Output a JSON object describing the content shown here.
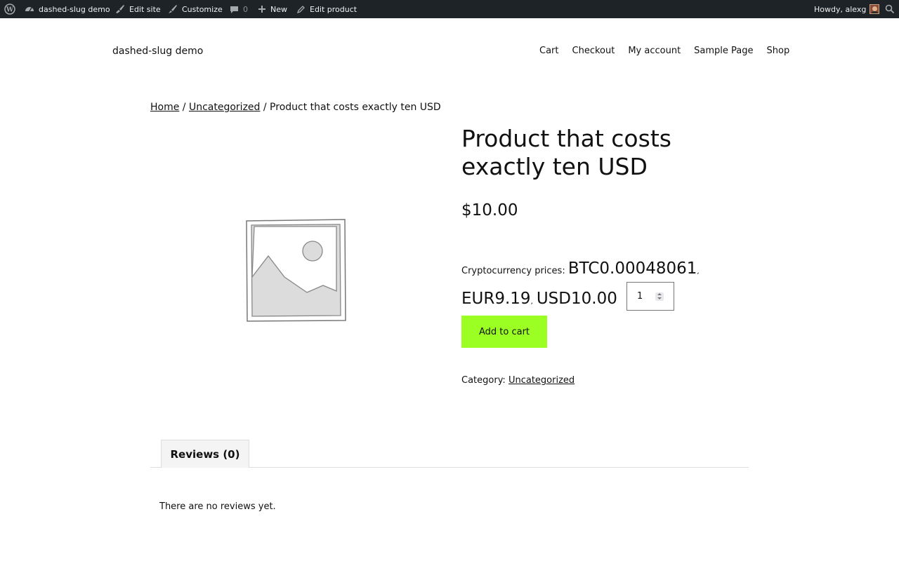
{
  "admin_bar": {
    "site_name": "dashed-slug demo",
    "edit_site": "Edit site",
    "customize": "Customize",
    "comments_count": "0",
    "new": "New",
    "edit_product": "Edit product",
    "howdy": "Howdy, alexg"
  },
  "header": {
    "site_title": "dashed-slug demo",
    "nav": [
      "Cart",
      "Checkout",
      "My account",
      "Sample Page",
      "Shop"
    ]
  },
  "breadcrumb": {
    "home": "Home",
    "separator": " / ",
    "category": "Uncategorized",
    "current": "Product that costs exactly ten USD"
  },
  "product": {
    "title": "Product that costs exactly ten USD",
    "price": "$10.00",
    "crypto_label": "Cryptocurrency prices: ",
    "crypto_prices": [
      "BTC0.00048061",
      "EUR9.19",
      "USD10.00"
    ],
    "crypto_separator": ",",
    "quantity": "1",
    "add_to_cart": "Add to cart",
    "category_label": "Category: ",
    "category": "Uncategorized"
  },
  "tabs": {
    "reviews_tab": "Reviews (0)",
    "no_reviews": "There are no reviews yet."
  },
  "colors": {
    "admin_bar_bg": "#1d2327",
    "add_to_cart_bg": "#9bff24"
  }
}
